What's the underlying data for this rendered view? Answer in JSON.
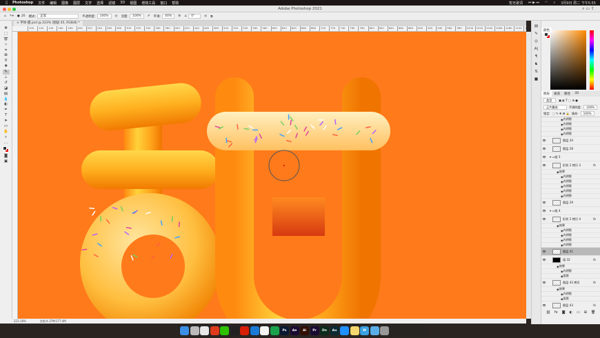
{
  "menubar": {
    "app": "Photoshop",
    "items": [
      "文件",
      "编辑",
      "图像",
      "图层",
      "文字",
      "选择",
      "滤镜",
      "3D",
      "视图",
      "增效工具",
      "窗口",
      "帮助"
    ],
    "now_playing": "暂无歌词",
    "clock": "3月9日 周二 下午5:55"
  },
  "window": {
    "title": "Adobe Photoshop 2021"
  },
  "options": {
    "mode_label": "模式:",
    "mode": "正常",
    "opacity_label": "不透明度:",
    "opacity": "100%",
    "flow_label": "流量:",
    "flow": "100%",
    "smoothing_label": "平滑:",
    "smoothing": "40%",
    "angle": "0°",
    "brush_size": "26"
  },
  "document": {
    "tab": "字体-甜.psd @ 223% (图层 45, RGB/8) *",
    "zoom": "223.18%",
    "doc_size": "文档:4.37M/177.4M"
  },
  "ruler": {
    "start": 100,
    "step": 20,
    "count": 52
  },
  "colors": {
    "canvas": "#ff7a1a",
    "foreground": "#333333",
    "background": "#e60000"
  },
  "color_panel": {
    "tab": "颜色"
  },
  "layers_panel": {
    "tabs": [
      "图层",
      "通道",
      "路径",
      "3D"
    ],
    "filter": "类型",
    "blend": "正片叠底",
    "opacity_label": "不透明度:",
    "opacity": "100%",
    "lock_label": "锁定:",
    "fill_label": "填充:",
    "fill": "100%",
    "rows": [
      {
        "kind": "effect",
        "name": "内阴影"
      },
      {
        "kind": "effect",
        "name": "内阴影"
      },
      {
        "kind": "effect",
        "name": "内阴影"
      },
      {
        "kind": "effect",
        "name": "内阴影"
      },
      {
        "kind": "layer",
        "name": "图层 34"
      },
      {
        "kind": "layer",
        "name": "图层 28"
      },
      {
        "kind": "group",
        "name": "组 5"
      },
      {
        "kind": "layer",
        "name": "形状 2 拷贝 3",
        "fx": "fx"
      },
      {
        "kind": "effect",
        "name": "效果"
      },
      {
        "kind": "effect",
        "name": "内阴影"
      },
      {
        "kind": "effect",
        "name": "内阴影"
      },
      {
        "kind": "effect",
        "name": "内阴影"
      },
      {
        "kind": "effect",
        "name": "内阴影"
      },
      {
        "kind": "effect",
        "name": "内阴影"
      },
      {
        "kind": "layer",
        "name": "图层 29"
      },
      {
        "kind": "group",
        "name": "组 4"
      },
      {
        "kind": "layer",
        "name": "形状 2 拷贝 4",
        "fx": "fx"
      },
      {
        "kind": "effect",
        "name": "效果"
      },
      {
        "kind": "effect",
        "name": "内阴影"
      },
      {
        "kind": "effect",
        "name": "内阴影"
      },
      {
        "kind": "effect",
        "name": "内阴影"
      },
      {
        "kind": "effect",
        "name": "内阴影"
      },
      {
        "kind": "layer",
        "name": "图层 41",
        "selected": true
      },
      {
        "kind": "layer",
        "name": "组 32",
        "fx": "fx",
        "mask": true
      },
      {
        "kind": "effect",
        "name": "效果"
      },
      {
        "kind": "effect",
        "name": "内阴影"
      },
      {
        "kind": "effect",
        "name": "投影"
      },
      {
        "kind": "layer",
        "name": "图层 43 拷贝",
        "fx": "fx"
      },
      {
        "kind": "effect",
        "name": "效果"
      },
      {
        "kind": "effect",
        "name": "内阴影"
      },
      {
        "kind": "effect",
        "name": "投影"
      },
      {
        "kind": "layer",
        "name": "图层 43",
        "fx": "fx"
      },
      {
        "kind": "effect",
        "name": "效果"
      },
      {
        "kind": "effect",
        "name": "内阴影"
      },
      {
        "kind": "effect",
        "name": "投影"
      },
      {
        "kind": "layer",
        "name": "图层 42 拷贝"
      },
      {
        "kind": "layer",
        "name": "图层 42"
      }
    ]
  },
  "dock": [
    {
      "name": "finder",
      "label": "",
      "color": "#3a8ee6"
    },
    {
      "name": "launchpad",
      "label": "",
      "color": "#bbb"
    },
    {
      "name": "chrome",
      "label": "",
      "color": "#e8e8e8"
    },
    {
      "name": "x-app",
      "label": "",
      "color": "#e03a1e"
    },
    {
      "name": "wechat",
      "label": "",
      "color": "#2dc100"
    },
    {
      "name": "qq",
      "label": "",
      "color": "#222"
    },
    {
      "name": "netease-music",
      "label": "",
      "color": "#d81e06"
    },
    {
      "name": "edge",
      "label": "",
      "color": "#1b7ad6"
    },
    {
      "name": "white-app",
      "label": "",
      "color": "#f4f4f4"
    },
    {
      "name": "green-app",
      "label": "",
      "color": "#1aa34a"
    },
    {
      "name": "photoshop",
      "label": "Ps",
      "color": "#0b1a33"
    },
    {
      "name": "after-effects",
      "label": "Ae",
      "color": "#1a0b33"
    },
    {
      "name": "illustrator",
      "label": "Ai",
      "color": "#330f00"
    },
    {
      "name": "premiere",
      "label": "Pr",
      "color": "#1a0b33"
    },
    {
      "name": "dimension",
      "label": "Dn",
      "color": "#0b2a1a"
    },
    {
      "name": "audition",
      "label": "Au",
      "color": "#0b2a33"
    },
    {
      "name": "app-store",
      "label": "",
      "color": "#1e90ff"
    },
    {
      "name": "notes",
      "label": "",
      "color": "#f5d76e"
    },
    {
      "name": "wps",
      "label": "W",
      "color": "#3aa0e0"
    },
    {
      "name": "folder",
      "label": "",
      "color": "#5aaee8"
    },
    {
      "name": "trash",
      "label": "",
      "color": "#999"
    }
  ]
}
